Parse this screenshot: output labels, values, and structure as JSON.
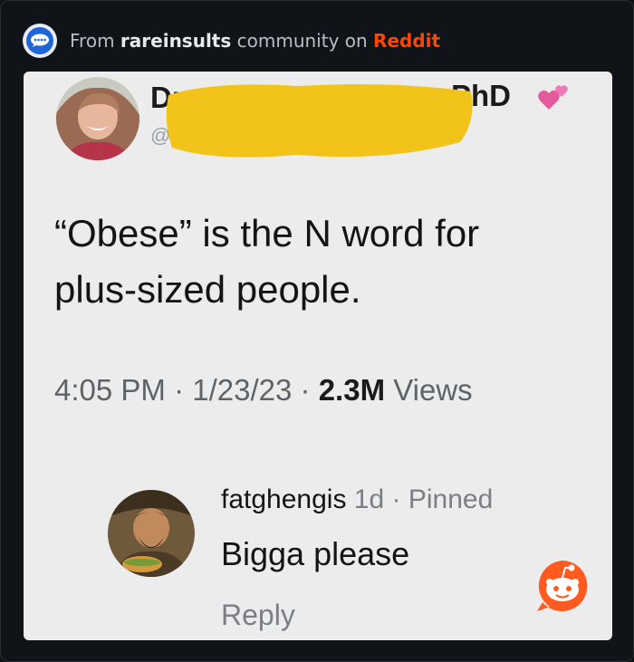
{
  "header": {
    "prefix": "From",
    "community": "rareinsults",
    "middle": "community on",
    "site": "Reddit",
    "icon": "speech-bubble-icon"
  },
  "tweet": {
    "name_prefix": "Dr.",
    "name_suffix": "PhD",
    "handle_prefix": "@",
    "emoji": "two-hearts-icon",
    "text_line1": "“Obese” is the N word for",
    "text_line2": "plus-sized people.",
    "time": "4:05 PM",
    "date": "1/23/23",
    "views_count": "2.3M",
    "views_label": "Views",
    "separator": "·"
  },
  "comment": {
    "username": "fatghengis",
    "age": "1d",
    "separator": "·",
    "status": "Pinned",
    "text": "Bigga please",
    "reply_label": "Reply"
  },
  "colors": {
    "reddit_accent": "#ff4500",
    "redaction": "#f2c319",
    "card_bg": "#ececec"
  }
}
